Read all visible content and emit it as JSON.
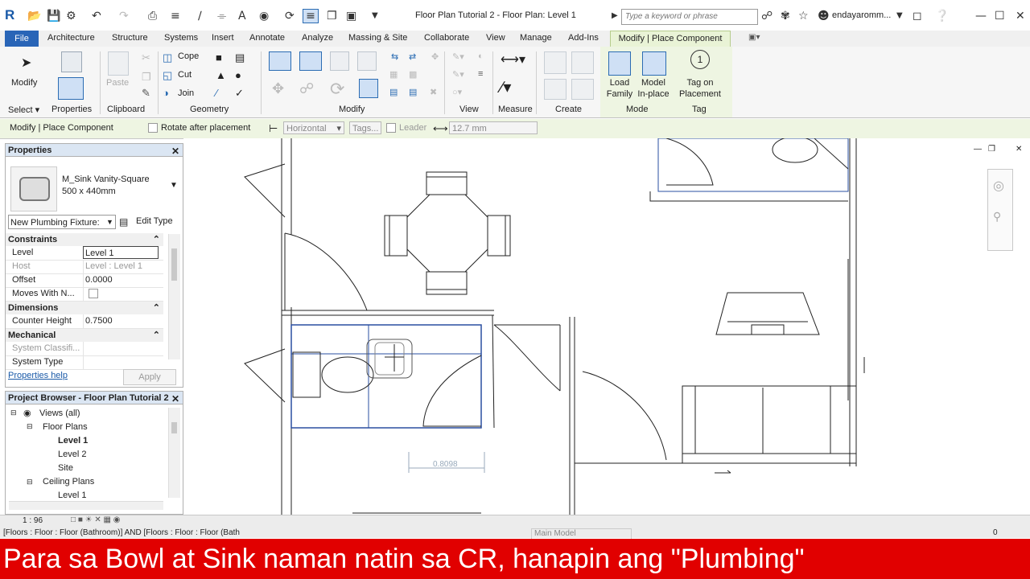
{
  "app": {
    "logo": "R",
    "title": "Floor Plan Tutorial 2 - Floor Plan: Level 1",
    "search_placeholder": "Type a keyword or phrase",
    "user": "endayaromm..."
  },
  "tabs": [
    "File",
    "Architecture",
    "Structure",
    "Systems",
    "Insert",
    "Annotate",
    "Analyze",
    "Massing & Site",
    "Collaborate",
    "View",
    "Manage",
    "Add-Ins",
    "Modify | Place Component"
  ],
  "ribbon": {
    "modify": "Modify",
    "select": "Select",
    "properties": "Properties",
    "paste": "Paste",
    "clipboard": "Clipboard",
    "cope": "Cope",
    "cut": "Cut",
    "join": "Join",
    "geometry": "Geometry",
    "modify_panel": "Modify",
    "view": "View",
    "measure": "Measure",
    "create": "Create",
    "load_family": "Load Family",
    "model_inplace": "Model In-place",
    "mode": "Mode",
    "tag_on_placement": "Tag on Placement",
    "tag": "Tag"
  },
  "options_bar": {
    "context": "Modify | Place Component",
    "rotate": "Rotate after placement",
    "orientation": "Horizontal",
    "tags": "Tags...",
    "leader": "Leader",
    "length": "12.7 mm"
  },
  "properties": {
    "title": "Properties",
    "type_name": "M_Sink Vanity-Square",
    "type_size": "500 x 440mm",
    "selector": "New Plumbing Fixture:",
    "edit_type": "Edit Type",
    "groups": {
      "constraints": "Constraints",
      "dimensions": "Dimensions",
      "mechanical": "Mechanical"
    },
    "rows": {
      "level": {
        "k": "Level",
        "v": "Level 1"
      },
      "host": {
        "k": "Host",
        "v": "Level : Level 1"
      },
      "offset": {
        "k": "Offset",
        "v": "0.0000"
      },
      "moves": {
        "k": "Moves With N...",
        "v": ""
      },
      "counter": {
        "k": "Counter Height",
        "v": "0.7500"
      },
      "system_class": {
        "k": "System Classifi...",
        "v": ""
      },
      "system_type": {
        "k": "System Type",
        "v": ""
      }
    },
    "help": "Properties help",
    "apply": "Apply"
  },
  "project_browser": {
    "title": "Project Browser - Floor Plan Tutorial 2",
    "items": [
      "Views (all)",
      "Floor Plans",
      "Level 1",
      "Level 2",
      "Site",
      "Ceiling Plans",
      "Level 1"
    ]
  },
  "canvas": {
    "dimension": "0.8098"
  },
  "status": {
    "scale": "1 : 96",
    "filter": "[Floors : Floor : Floor (Bathroom)] AND [Floors : Floor : Floor (Bath",
    "model": "Main Model",
    "count": "0"
  },
  "caption": "Para sa Bowl at Sink naman natin sa CR, hanapin ang \"Plumbing\""
}
